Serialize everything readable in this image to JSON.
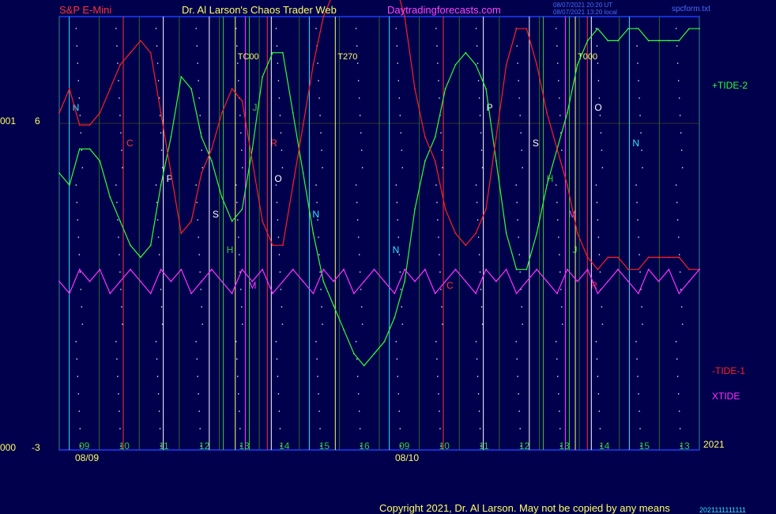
{
  "header": {
    "symbol": "S&P E-Mini",
    "author": "Dr. Al Larson's Chaos Trader Web",
    "site": "Daytradingforecasts.com",
    "timestamp_ut": "08/07/2021 20:20 UT",
    "timestamp_local": "08/07/2021 13:20 local",
    "file": "spcform.txt"
  },
  "footer": {
    "copyright": "Copyright 2021, Dr. Al Larson. May not be copied by any means",
    "scramble": "2021111111111"
  },
  "left_axis": {
    "top_code": "001",
    "top_value": "6",
    "bottom_code": "000",
    "bottom_value": "-3"
  },
  "colors": {
    "background": "#00004d",
    "plot_border": "#1a3cff",
    "tide_plus": "#33ff33",
    "tide_minus": "#ff2020",
    "xtide": "#ff33ff",
    "hour_grid": "#2a6b2a",
    "sun": "#ffffff",
    "moon": "#33e6ff",
    "mars": "#ff3333",
    "venus": "#2a6bff",
    "jupiter": "#33cc33",
    "mercury": "#ff44ff",
    "timing": "#ffff66"
  },
  "chart_data": {
    "type": "line",
    "title": "S&P E-Mini",
    "ylim": [
      -3,
      6
    ],
    "hour_labels": [
      "09",
      "10",
      "11",
      "12",
      "13",
      "14",
      "15",
      "16",
      "09",
      "10",
      "11",
      "12",
      "13",
      "14",
      "15",
      "13"
    ],
    "date_labels": [
      "08/09",
      "08/10"
    ],
    "year_label": "2021",
    "timing_labels": [
      "TC00",
      "T270",
      "T000"
    ],
    "series": [
      {
        "name": "+TIDE-2",
        "color": "#33ff33",
        "values": [
          2.75,
          2.5,
          3.25,
          3.25,
          3.0,
          2.25,
          1.75,
          1.25,
          1.0,
          1.25,
          2.5,
          3.5,
          4.75,
          4.5,
          3.5,
          3.0,
          2.25,
          1.75,
          2.0,
          3.25,
          4.75,
          5.25,
          5.25,
          4.0,
          2.75,
          1.5,
          0.5,
          0.0,
          -0.5,
          -1.0,
          -1.25,
          -1.0,
          -0.75,
          -0.25,
          0.5,
          2.0,
          3.0,
          3.5,
          4.5,
          5.0,
          5.25,
          5.0,
          4.5,
          3.0,
          1.5,
          0.75,
          0.75,
          1.5,
          2.5,
          3.25,
          4.0,
          5.0,
          5.5,
          5.75,
          5.5,
          5.5,
          5.75,
          5.75,
          5.5,
          5.5,
          5.5,
          5.5,
          5.75,
          5.75
        ]
      },
      {
        "name": "-TIDE-1",
        "color": "#ff2020",
        "values": [
          4.0,
          4.5,
          3.75,
          3.75,
          4.0,
          4.5,
          5.0,
          5.25,
          5.5,
          5.25,
          4.0,
          2.75,
          1.5,
          1.75,
          2.75,
          3.25,
          4.0,
          4.5,
          4.25,
          3.0,
          1.75,
          1.25,
          1.25,
          2.5,
          3.75,
          5.0,
          6.0,
          6.5,
          7.0,
          7.5,
          7.75,
          7.5,
          7.25,
          6.75,
          6.0,
          4.5,
          3.5,
          3.0,
          2.0,
          1.5,
          1.25,
          1.5,
          2.0,
          3.5,
          5.0,
          5.75,
          5.75,
          5.0,
          4.0,
          3.25,
          2.5,
          1.5,
          1.0,
          0.75,
          1.0,
          1.0,
          0.75,
          0.75,
          1.0,
          1.0,
          1.0,
          1.0,
          0.75,
          0.75
        ]
      },
      {
        "name": "XTIDE",
        "color": "#ff33ff",
        "values": [
          0.5,
          0.25,
          0.75,
          0.5,
          0.75,
          0.25,
          0.5,
          0.75,
          0.5,
          0.25,
          0.75,
          0.5,
          0.75,
          0.25,
          0.5,
          0.75,
          0.5,
          0.25,
          0.75,
          0.5,
          0.75,
          0.25,
          0.5,
          0.75,
          0.5,
          0.25,
          0.75,
          0.5,
          0.75,
          0.25,
          0.5,
          0.75,
          0.5,
          0.25,
          0.75,
          0.5,
          0.75,
          0.25,
          0.5,
          0.75,
          0.5,
          0.25,
          0.75,
          0.5,
          0.75,
          0.25,
          0.5,
          0.75,
          0.5,
          0.25,
          0.75,
          0.5,
          0.75,
          0.25,
          0.5,
          0.75,
          0.5,
          0.25,
          0.75,
          0.5,
          0.75,
          0.25,
          0.5,
          0.75
        ]
      }
    ],
    "series_labels": [
      {
        "text": "+TIDE-2",
        "color": "#33ff33"
      },
      {
        "text": "-TIDE-1",
        "color": "#ff2020"
      },
      {
        "text": "XTIDE",
        "color": "#ff33ff"
      }
    ],
    "planet_lines": [
      {
        "letter": "N",
        "color": "#33e6ff",
        "x_hour": 0.25
      },
      {
        "letter": "C",
        "color": "#ff3333",
        "x_hour": 1.6
      },
      {
        "letter": "P",
        "color": "#ffffff",
        "x_hour": 2.6
      },
      {
        "letter": "S",
        "color": "#ffffff",
        "x_hour": 3.75
      },
      {
        "letter": "H",
        "color": "#33cc33",
        "x_hour": 4.1
      },
      {
        "letter": "M",
        "color": "#ff44ff",
        "x_hour": 4.65
      },
      {
        "letter": "J",
        "color": "#33cc33",
        "x_hour": 4.75
      },
      {
        "letter": "R",
        "color": "#ff3333",
        "x_hour": 5.2
      },
      {
        "letter": "O",
        "color": "#ffffff",
        "x_hour": 5.3
      },
      {
        "letter": "N",
        "color": "#33e6ff",
        "x_hour": 6.25
      },
      {
        "letter": "N",
        "color": "#33e6ff",
        "x_hour": 8.25
      },
      {
        "letter": "C",
        "color": "#ff3333",
        "x_hour": 9.6
      },
      {
        "letter": "P",
        "color": "#ffffff",
        "x_hour": 10.6
      },
      {
        "letter": "S",
        "color": "#ffffff",
        "x_hour": 11.75
      },
      {
        "letter": "H",
        "color": "#33cc33",
        "x_hour": 12.1
      },
      {
        "letter": "M",
        "color": "#ff44ff",
        "x_hour": 12.65
      },
      {
        "letter": "J",
        "color": "#33cc33",
        "x_hour": 12.75
      },
      {
        "letter": "R",
        "color": "#ff3333",
        "x_hour": 13.2
      },
      {
        "letter": "O",
        "color": "#ffffff",
        "x_hour": 13.3
      },
      {
        "letter": "N",
        "color": "#33e6ff",
        "x_hour": 14.25
      }
    ]
  }
}
